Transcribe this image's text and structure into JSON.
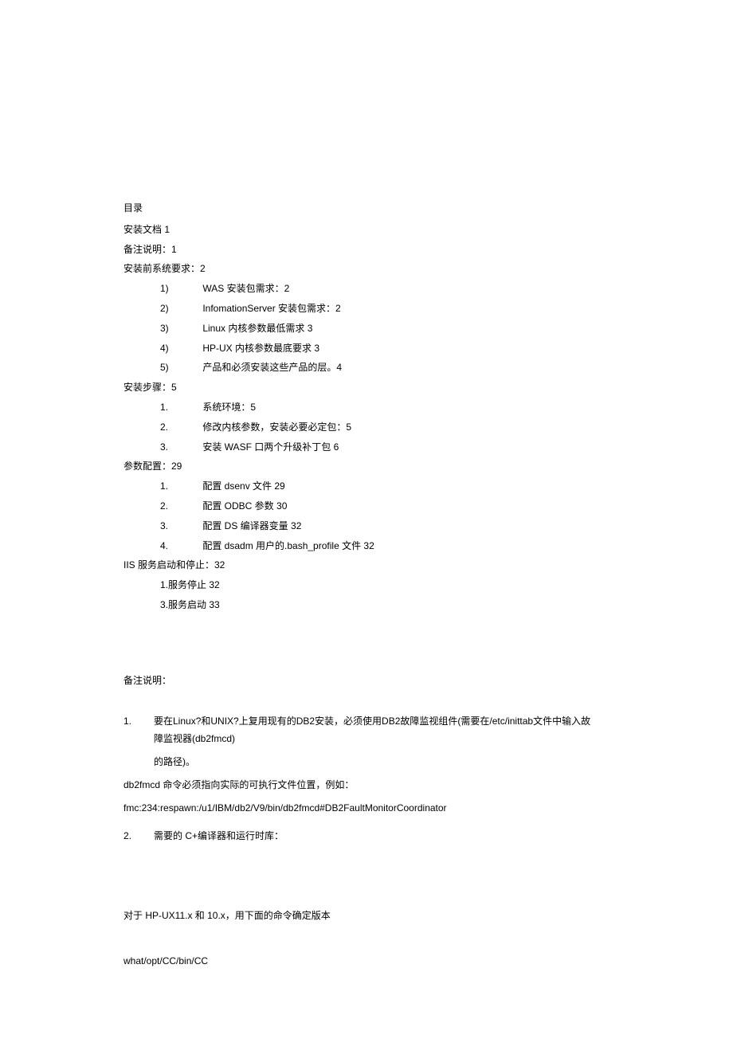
{
  "toc": {
    "title": "目录",
    "lines": [
      "安装文档 1",
      "备注说明：1",
      "安装前系统要求：2"
    ],
    "sub1": [
      {
        "num": "1)",
        "text": "WAS 安装包需求：2"
      },
      {
        "num": "2)",
        "text": "InfomationServer 安装包需求：2"
      },
      {
        "num": "3)",
        "text": "Linux 内核参数最低需求 3"
      },
      {
        "num": "4)",
        "text": "HP-UX 内核参数最底要求 3"
      },
      {
        "num": "5)",
        "text": "产品和必须安装这些产品的层。4"
      }
    ],
    "line2": "安装步骤：5",
    "sub2": [
      {
        "num": "1.",
        "text": "系统环境：5"
      },
      {
        "num": "2.",
        "text": "修改内核参数，安装必要必定包：5"
      },
      {
        "num": "3.",
        "text": "安装 WASF 口两个升级补丁包 6"
      }
    ],
    "line3": "参数配置：29",
    "sub3": [
      {
        "num": "1.",
        "text": "配置 dsenv 文件 29"
      },
      {
        "num": "2.",
        "text": "配置 ODBC 参数 30"
      },
      {
        "num": "3.",
        "text": "配置 DS 编译器变量 32"
      },
      {
        "num": "4.",
        "text": "配置 dsadm 用户的.bash_profile 文件 32"
      }
    ],
    "line4": "IIS 服务启动和停止：32",
    "sub4": [
      "1.服务停止 32",
      "3.服务启动 33"
    ]
  },
  "notes": {
    "heading": "备注说明：",
    "item1_num": "1.",
    "item1_line1": "要在Linux?和UNIX?上复用现有的DB2安装，必须使用DB2故障监视组件(需要在/etc/inittab文件中输入故障监视器(db2fmcd)",
    "item1_line2": "的路径)。",
    "para1": "db2fmcd 命令必须指向实际的可执行文件位置，例如：",
    "para2": "fmc:234:respawn:/u1/IBM/db2/V9/bin/db2fmcd#DB2FaultMonitorCoordinator",
    "item2_num": "2.",
    "item2_text": "需要的 C+编译器和运行时库：",
    "para3": "对于 HP-UX11.x 和 10.x，用下面的命令确定版本",
    "para4": "what/opt/CC/bin/CC"
  }
}
